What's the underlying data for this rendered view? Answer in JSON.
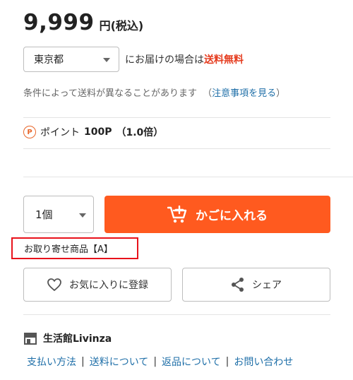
{
  "price": {
    "amount": "9,999",
    "unit_label": "円(税込)"
  },
  "delivery": {
    "prefecture": "東京都",
    "text": "にお届けの場合は",
    "free_shipping": "送料無料",
    "condition_text": "条件によって送料が異なることがあります",
    "notice_open": "（",
    "notice_link": "注意事項を見る",
    "notice_close": "）"
  },
  "points": {
    "icon_letter": "P",
    "label": "ポイント",
    "value": "100P",
    "rate": "（1.0倍）"
  },
  "purchase": {
    "quantity": "1個",
    "cart_button": "かごに入れる",
    "order_note": "お取り寄せ商品【A】"
  },
  "actions": {
    "favorite": "お気に入りに登録",
    "share": "シェア"
  },
  "shop": {
    "name": "生活館Livinza",
    "links": [
      "支払い方法",
      "送料について",
      "返品について",
      "お問い合わせ"
    ],
    "separator": "|"
  },
  "colors": {
    "accent": "#ff5a1f",
    "free_shipping": "#e53c1f",
    "link": "#1f6fa8",
    "highlight_border": "#e8121b"
  }
}
